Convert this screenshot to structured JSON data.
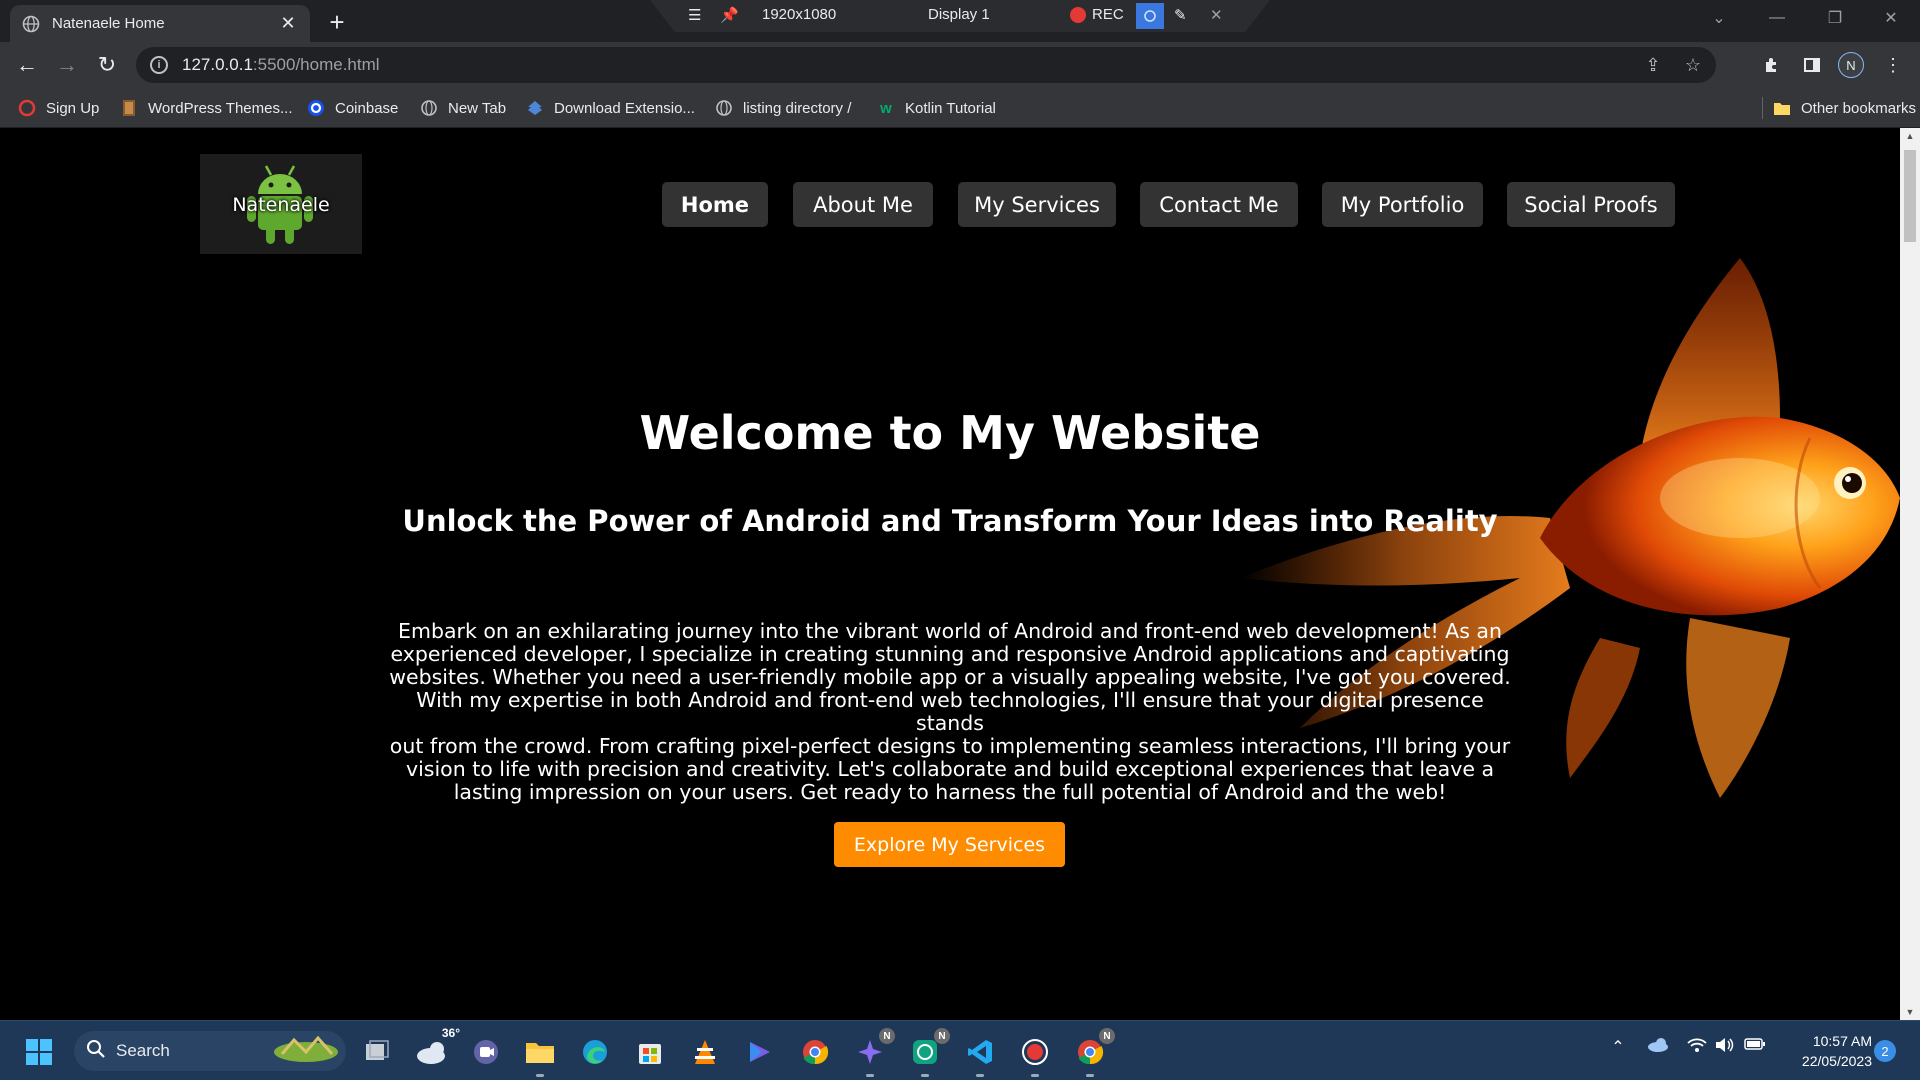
{
  "browser": {
    "tab_title": "Natenaele Home",
    "url_host": "127.0.0.1",
    "url_path": ":5500/home.html",
    "profile_initial": "N",
    "bookmarks": [
      {
        "label": "Sign Up",
        "icon": "opera-icon"
      },
      {
        "label": "WordPress Themes...",
        "icon": "wordpress-icon"
      },
      {
        "label": "Coinbase",
        "icon": "coinbase-icon"
      },
      {
        "label": "New Tab",
        "icon": "globe-icon"
      },
      {
        "label": "Download Extensio...",
        "icon": "download-icon"
      },
      {
        "label": "listing directory /",
        "icon": "globe-icon"
      },
      {
        "label": "Kotlin Tutorial",
        "icon": "w3schools-icon"
      }
    ],
    "other_bookmarks": "Other bookmarks"
  },
  "recorder": {
    "resolution": "1920x1080",
    "display": "Display 1",
    "rec_label": "REC"
  },
  "page": {
    "logo_text": "Natenaele",
    "nav": [
      {
        "label": "Home",
        "active": true
      },
      {
        "label": "About Me"
      },
      {
        "label": "My Services"
      },
      {
        "label": "Contact Me"
      },
      {
        "label": "My Portfolio"
      },
      {
        "label": "Social Proofs"
      }
    ],
    "hero_title": "Welcome to My Website",
    "hero_subtitle": "Unlock the Power of Android and Transform Your Ideas into Reality",
    "hero_lines": [
      "Embark on an exhilarating journey into the vibrant world of Android and front-end web development! As an",
      "experienced developer, I specialize in creating stunning and responsive Android applications and captivating",
      "websites. Whether you need a user-friendly mobile app or a visually appealing website, I've got you covered.",
      "With my expertise in both Android and front-end web technologies, I'll ensure that your digital presence stands",
      "out from the crowd. From crafting pixel-perfect designs to implementing seamless interactions, I'll bring your",
      "vision to life with precision and creativity. Let's collaborate and build exceptional experiences that leave a",
      "lasting impression on your users. Get ready to harness the full potential of Android and the web!"
    ],
    "cta_label": "Explore My Services",
    "accent_color": "#ff8c00"
  },
  "taskbar": {
    "search_label": "Search",
    "weather_temp": "36°",
    "badge_letter": "N",
    "time": "10:57 AM",
    "date": "22/05/2023",
    "notification_count": "2"
  }
}
